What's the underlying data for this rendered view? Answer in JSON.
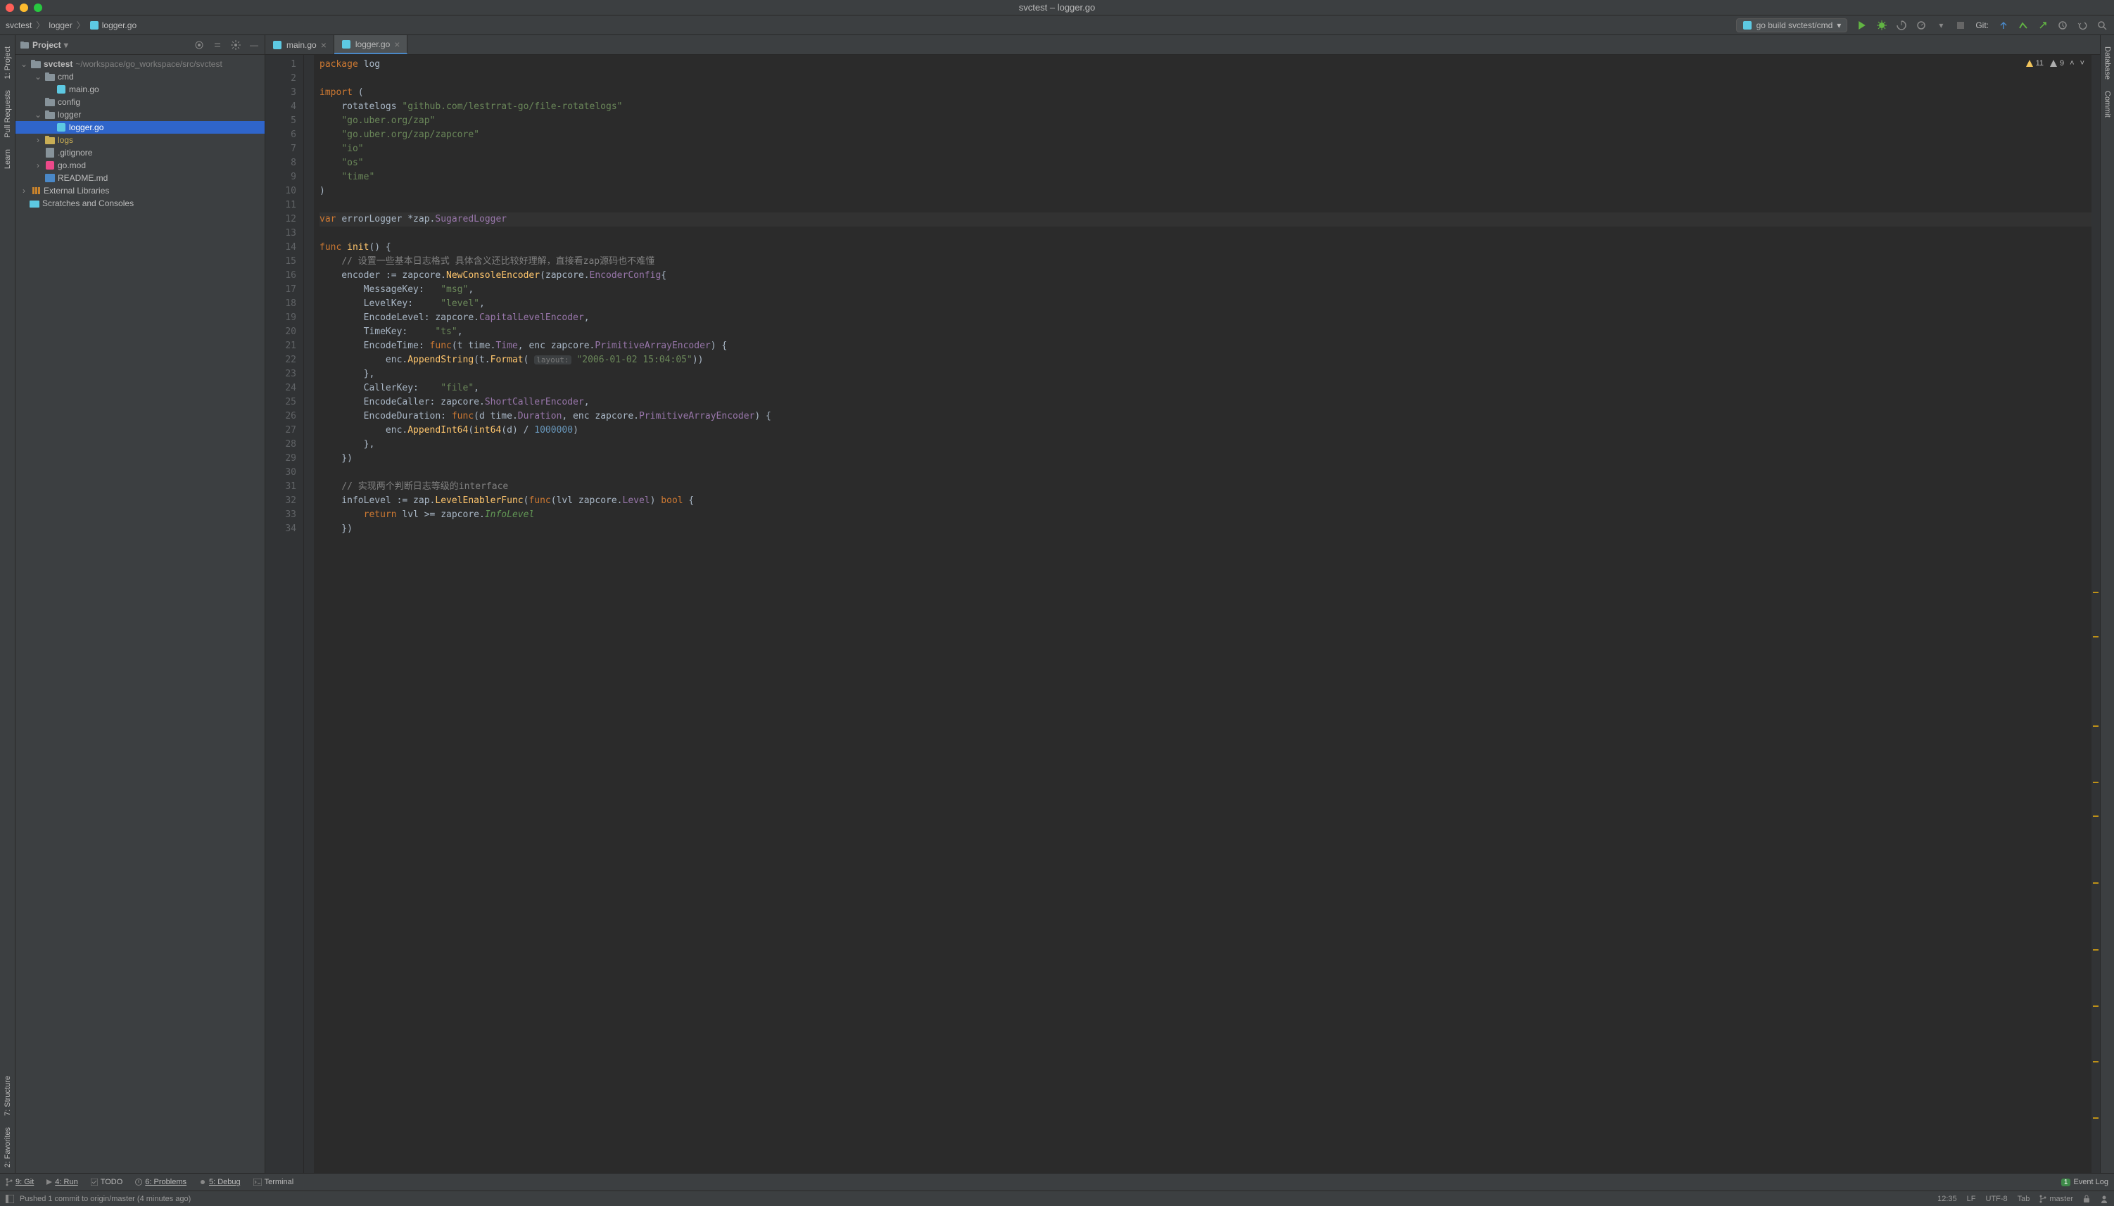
{
  "window": {
    "title": "svctest – logger.go"
  },
  "breadcrumbs": [
    "svctest",
    "logger",
    "logger.go"
  ],
  "runConfig": {
    "label": "go build svctest/cmd"
  },
  "git": {
    "label": "Git:"
  },
  "projectPanel": {
    "title": "Project"
  },
  "tree": {
    "root": {
      "name": "svctest",
      "path": "~/workspace/go_workspace/src/svctest"
    },
    "cmd": "cmd",
    "main_go": "main.go",
    "config": "config",
    "logger_folder": "logger",
    "logger_go": "logger.go",
    "logs": "logs",
    "gitignore": ".gitignore",
    "gomod": "go.mod",
    "readme": "README.md",
    "external": "External Libraries",
    "scratches": "Scratches and Consoles"
  },
  "tabs": [
    {
      "name": "main.go",
      "active": false
    },
    {
      "name": "logger.go",
      "active": true
    }
  ],
  "inspections": {
    "warnings": "11",
    "weak": "9"
  },
  "code": {
    "lines": [
      {
        "n": 1,
        "segs": [
          [
            "kw",
            "package "
          ],
          [
            "pkg",
            "log"
          ]
        ]
      },
      {
        "n": 2,
        "segs": []
      },
      {
        "n": 3,
        "segs": [
          [
            "kw",
            "import "
          ],
          [
            "ident",
            "("
          ]
        ]
      },
      {
        "n": 4,
        "segs": [
          [
            "ident",
            "    "
          ],
          [
            "pkg",
            "rotatelogs"
          ],
          [
            "ident",
            " "
          ],
          [
            "str",
            "\"github.com/lestrrat-go/file-rotatelogs\""
          ]
        ]
      },
      {
        "n": 5,
        "segs": [
          [
            "ident",
            "    "
          ],
          [
            "str",
            "\"go.uber.org/zap\""
          ]
        ]
      },
      {
        "n": 6,
        "segs": [
          [
            "ident",
            "    "
          ],
          [
            "str",
            "\"go.uber.org/zap/zapcore\""
          ]
        ]
      },
      {
        "n": 7,
        "segs": [
          [
            "ident",
            "    "
          ],
          [
            "str",
            "\"io\""
          ]
        ]
      },
      {
        "n": 8,
        "segs": [
          [
            "ident",
            "    "
          ],
          [
            "str",
            "\"os\""
          ]
        ]
      },
      {
        "n": 9,
        "segs": [
          [
            "ident",
            "    "
          ],
          [
            "str",
            "\"time\""
          ]
        ]
      },
      {
        "n": 10,
        "segs": [
          [
            "ident",
            ")"
          ]
        ]
      },
      {
        "n": 11,
        "segs": []
      },
      {
        "n": 12,
        "segs": [
          [
            "kw",
            "var "
          ],
          [
            "ident",
            "errorLogger *zap."
          ],
          [
            "typeref",
            "SugaredLogger"
          ]
        ],
        "current": true
      },
      {
        "n": 13,
        "segs": []
      },
      {
        "n": 14,
        "segs": [
          [
            "kw",
            "func "
          ],
          [
            "fn",
            "init"
          ],
          [
            "ident",
            "() {"
          ]
        ]
      },
      {
        "n": 15,
        "segs": [
          [
            "ident",
            "    "
          ],
          [
            "cmt",
            "// 设置一些基本日志格式 具体含义还比较好理解，直接看zap源码也不难懂"
          ]
        ]
      },
      {
        "n": 16,
        "segs": [
          [
            "ident",
            "    encoder := zapcore."
          ],
          [
            "fn",
            "NewConsoleEncoder"
          ],
          [
            "ident",
            "(zapcore."
          ],
          [
            "typeref",
            "EncoderConfig"
          ],
          [
            "ident",
            "{"
          ]
        ]
      },
      {
        "n": 17,
        "segs": [
          [
            "ident",
            "        MessageKey:   "
          ],
          [
            "str",
            "\"msg\""
          ],
          [
            "ident",
            ","
          ]
        ]
      },
      {
        "n": 18,
        "segs": [
          [
            "ident",
            "        LevelKey:     "
          ],
          [
            "str",
            "\"level\""
          ],
          [
            "ident",
            ","
          ]
        ]
      },
      {
        "n": 19,
        "segs": [
          [
            "ident",
            "        EncodeLevel: zapcore."
          ],
          [
            "typeref",
            "CapitalLevelEncoder"
          ],
          [
            "ident",
            ","
          ]
        ]
      },
      {
        "n": 20,
        "segs": [
          [
            "ident",
            "        TimeKey:     "
          ],
          [
            "str",
            "\"ts\""
          ],
          [
            "ident",
            ","
          ]
        ]
      },
      {
        "n": 21,
        "segs": [
          [
            "ident",
            "        EncodeTime: "
          ],
          [
            "kw",
            "func"
          ],
          [
            "ident",
            "(t time."
          ],
          [
            "typeref",
            "Time"
          ],
          [
            "ident",
            ", enc zapcore."
          ],
          [
            "typeref",
            "PrimitiveArrayEncoder"
          ],
          [
            "ident",
            ") {"
          ]
        ]
      },
      {
        "n": 22,
        "segs": [
          [
            "ident",
            "            enc."
          ],
          [
            "fn",
            "AppendString"
          ],
          [
            "ident",
            "(t."
          ],
          [
            "fn",
            "Format"
          ],
          [
            "ident",
            "( "
          ],
          [
            "hint",
            "layout:"
          ],
          [
            "ident",
            " "
          ],
          [
            "str",
            "\"2006-01-02 15:04:05\""
          ],
          [
            "ident",
            "))"
          ]
        ]
      },
      {
        "n": 23,
        "segs": [
          [
            "ident",
            "        },"
          ]
        ]
      },
      {
        "n": 24,
        "segs": [
          [
            "ident",
            "        CallerKey:    "
          ],
          [
            "str",
            "\"file\""
          ],
          [
            "ident",
            ","
          ]
        ]
      },
      {
        "n": 25,
        "segs": [
          [
            "ident",
            "        EncodeCaller: zapcore."
          ],
          [
            "typeref",
            "ShortCallerEncoder"
          ],
          [
            "ident",
            ","
          ]
        ]
      },
      {
        "n": 26,
        "segs": [
          [
            "ident",
            "        EncodeDuration: "
          ],
          [
            "kw",
            "func"
          ],
          [
            "ident",
            "(d time."
          ],
          [
            "typeref",
            "Duration"
          ],
          [
            "ident",
            ", enc zapcore."
          ],
          [
            "typeref",
            "PrimitiveArrayEncoder"
          ],
          [
            "ident",
            ") {"
          ]
        ]
      },
      {
        "n": 27,
        "segs": [
          [
            "ident",
            "            enc."
          ],
          [
            "fn",
            "AppendInt64"
          ],
          [
            "ident",
            "("
          ],
          [
            "fn",
            "int64"
          ],
          [
            "ident",
            "(d) / "
          ],
          [
            "num",
            "1000000"
          ],
          [
            "ident",
            ")"
          ]
        ]
      },
      {
        "n": 28,
        "segs": [
          [
            "ident",
            "        },"
          ]
        ]
      },
      {
        "n": 29,
        "segs": [
          [
            "ident",
            "    })"
          ]
        ]
      },
      {
        "n": 30,
        "segs": []
      },
      {
        "n": 31,
        "segs": [
          [
            "ident",
            "    "
          ],
          [
            "cmt",
            "// 实现两个判断日志等级的interface"
          ]
        ]
      },
      {
        "n": 32,
        "segs": [
          [
            "ident",
            "    infoLevel := zap."
          ],
          [
            "fn",
            "LevelEnablerFunc"
          ],
          [
            "ident",
            "("
          ],
          [
            "kw",
            "func"
          ],
          [
            "ident",
            "(lvl zapcore."
          ],
          [
            "typeref",
            "Level"
          ],
          [
            "ident",
            ") "
          ],
          [
            "kw",
            "bool"
          ],
          [
            "ident",
            " {"
          ]
        ]
      },
      {
        "n": 33,
        "segs": [
          [
            "ident",
            "        "
          ],
          [
            "kw",
            "return"
          ],
          [
            "ident",
            " lvl >= zapcore."
          ],
          [
            "mutedtype",
            "InfoLevel"
          ]
        ]
      },
      {
        "n": 34,
        "segs": [
          [
            "ident",
            "    })"
          ]
        ]
      }
    ]
  },
  "toolTabs": {
    "git": "9: Git",
    "run": "4: Run",
    "todo": "TODO",
    "problems": "6: Problems",
    "debug": "5: Debug",
    "terminal": "Terminal",
    "eventlog": "Event Log"
  },
  "status": {
    "message": "Pushed 1 commit to origin/master (4 minutes ago)",
    "pos": "12:35",
    "lf": "LF",
    "enc": "UTF-8",
    "tab": "Tab",
    "branch": "master"
  },
  "leftGutter": {
    "project": "1: Project",
    "pull": "Pull Requests",
    "learn": "Learn",
    "structure": "7: Structure",
    "favorites": "2: Favorites"
  },
  "rightGutter": {
    "database": "Database",
    "commit": "Commit"
  }
}
